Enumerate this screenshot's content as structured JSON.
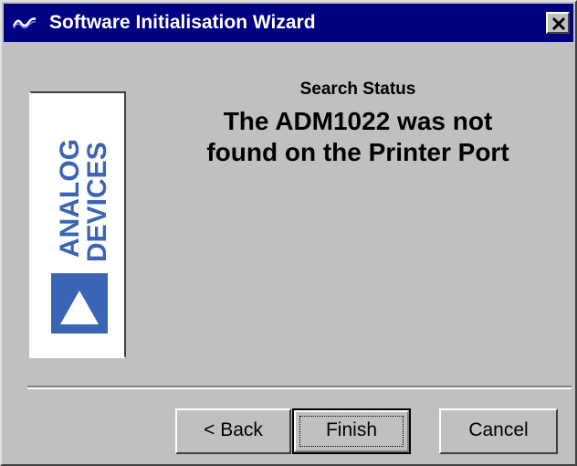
{
  "window": {
    "title": "Software Initialisation Wizard",
    "title_icon": "analog-waveform-icon",
    "close_icon": "close-icon",
    "titlebar_color": "#000080"
  },
  "logo": {
    "line1": "ANALOG",
    "line2": "DEVICES",
    "icon": "analog-devices-triangle-logo",
    "brand_color": "#3c64b4"
  },
  "status": {
    "heading": "Search Status",
    "message_line1": "The ADM1022 was not",
    "message_line2": "found on the Printer Port"
  },
  "buttons": {
    "back": "< Back",
    "finish": "Finish",
    "cancel": "Cancel"
  }
}
